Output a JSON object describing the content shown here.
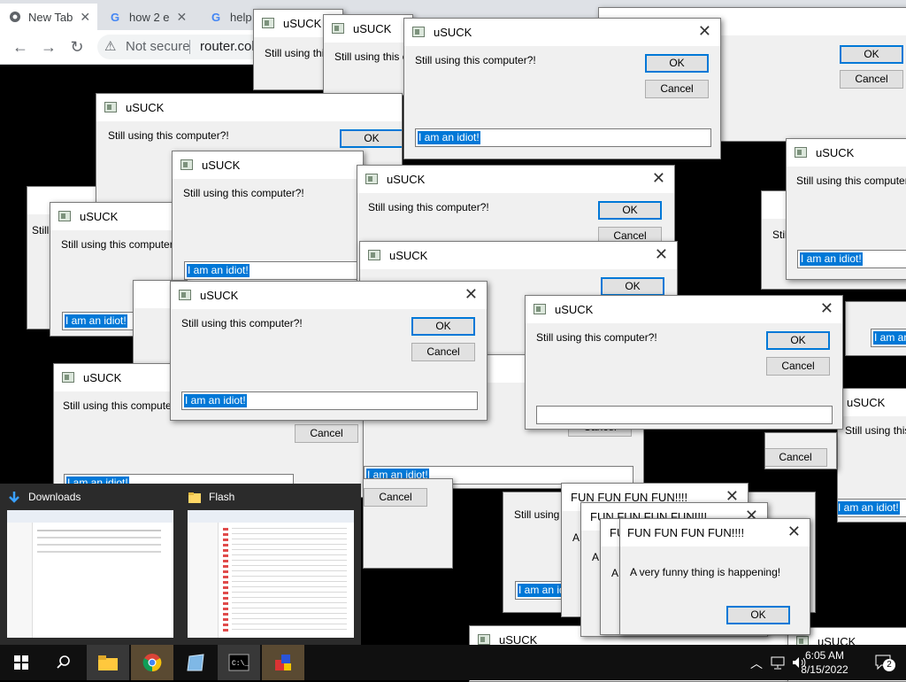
{
  "browser": {
    "tabs": [
      {
        "title": "New Tab"
      },
      {
        "title": "how 2 e"
      },
      {
        "title": "help r"
      }
    ],
    "security_label": "Not secure",
    "url": "router.col"
  },
  "dialog_title": "uSUCK",
  "dialog_message": "Still using this computer?!",
  "input_value": "I am an idiot!",
  "ok_label": "OK",
  "cancel_label": "Cancel",
  "fun_dialog": {
    "title": "FUN FUN FUN FUN!!!!",
    "message": "A very funny thing is happening!",
    "ok_label": "OK"
  },
  "thumbnails": [
    {
      "title": "Downloads"
    },
    {
      "title": "Flash"
    }
  ],
  "clock": {
    "time": "6:05 AM",
    "date": "8/15/2022"
  },
  "notifications": "2",
  "colors": {
    "selection": "#0078d7",
    "taskbar": "#101010",
    "dialog_bg": "#f0f0f0"
  }
}
